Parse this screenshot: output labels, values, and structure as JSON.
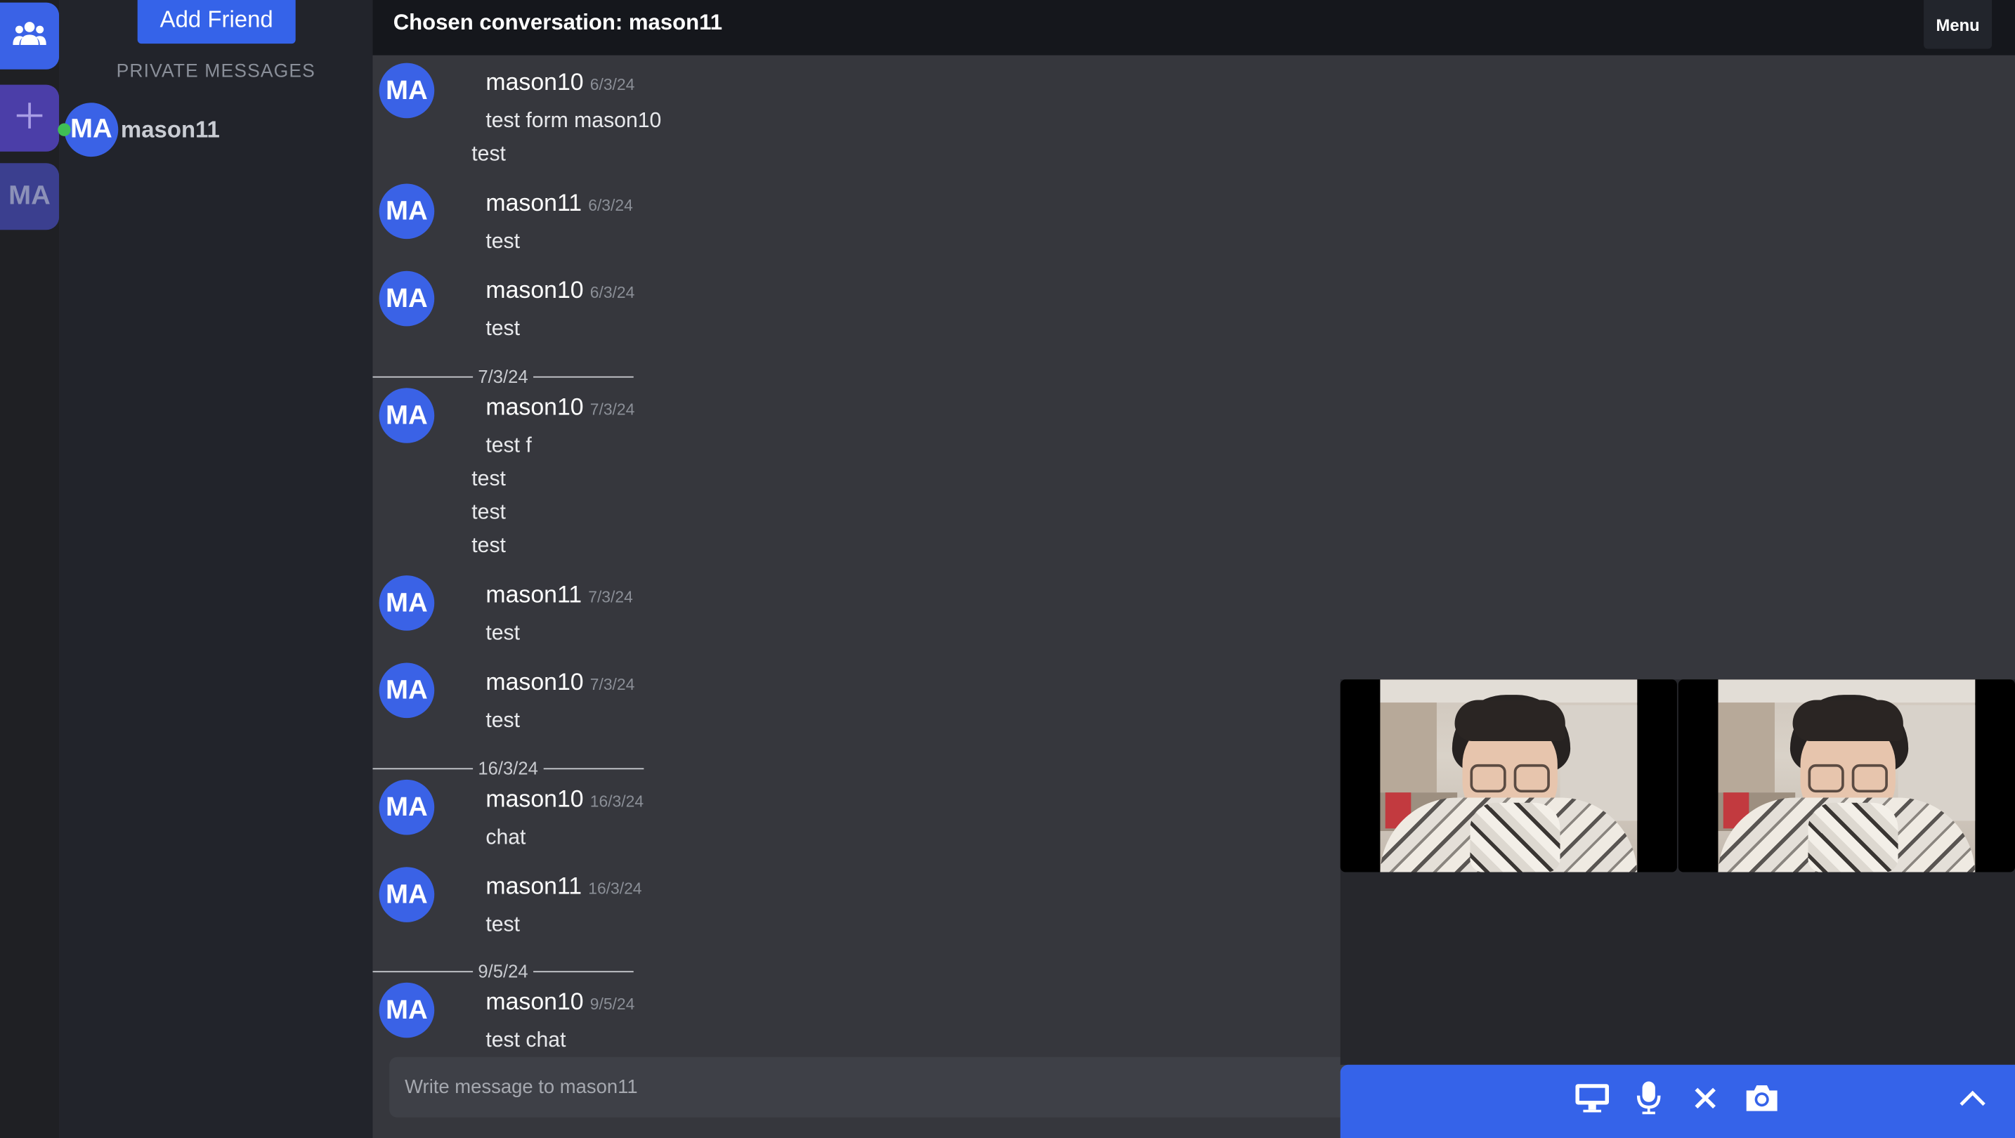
{
  "sidebar": {
    "add_friend_label": "Add Friend",
    "section_title": "PRIVATE MESSAGES",
    "friends": [
      {
        "avatar": "MA",
        "name": "mason11",
        "online": true
      }
    ]
  },
  "rail": {
    "home_icon": "people-icon",
    "add_icon": "plus-icon",
    "server_initials": "MA"
  },
  "header": {
    "title": "Chosen conversation: mason11",
    "menu_label": "Menu"
  },
  "messages": [
    {
      "avatar": "MA",
      "author": "mason10",
      "time": "6/3/24",
      "lines": [
        "test form mason10",
        "test"
      ]
    },
    {
      "avatar": "MA",
      "author": "mason11",
      "time": "6/3/24",
      "lines": [
        "test"
      ]
    },
    {
      "avatar": "MA",
      "author": "mason10",
      "time": "6/3/24",
      "lines": [
        "test"
      ]
    },
    {
      "divider": "7/3/24"
    },
    {
      "avatar": "MA",
      "author": "mason10",
      "time": "7/3/24",
      "lines": [
        "test f",
        "test",
        "test",
        "test"
      ]
    },
    {
      "avatar": "MA",
      "author": "mason11",
      "time": "7/3/24",
      "lines": [
        "test"
      ]
    },
    {
      "avatar": "MA",
      "author": "mason10",
      "time": "7/3/24",
      "lines": [
        "test"
      ]
    },
    {
      "divider": "16/3/24"
    },
    {
      "avatar": "MA",
      "author": "mason10",
      "time": "16/3/24",
      "lines": [
        "chat"
      ]
    },
    {
      "avatar": "MA",
      "author": "mason11",
      "time": "16/3/24",
      "lines": [
        "test"
      ]
    },
    {
      "divider": "9/5/24"
    },
    {
      "avatar": "MA",
      "author": "mason10",
      "time": "9/5/24",
      "lines": [
        "test chat"
      ]
    }
  ],
  "composer": {
    "placeholder": "Write message to mason11"
  },
  "call": {
    "controls": [
      "screen-share-icon",
      "microphone-icon",
      "close-icon",
      "camera-icon",
      "chevron-up-icon"
    ],
    "accent": "#3563e9"
  }
}
